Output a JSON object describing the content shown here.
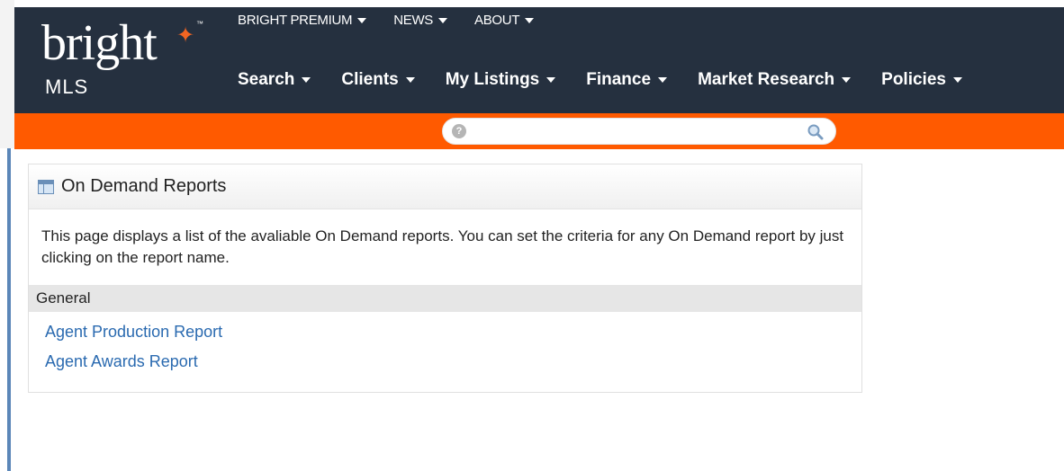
{
  "logo": {
    "word": "bright",
    "sub": "MLS",
    "tm": "™"
  },
  "topnav": [
    {
      "label": "BRIGHT PREMIUM"
    },
    {
      "label": "NEWS"
    },
    {
      "label": "ABOUT"
    }
  ],
  "mainnav": [
    {
      "label": "Search"
    },
    {
      "label": "Clients"
    },
    {
      "label": "My Listings"
    },
    {
      "label": "Finance"
    },
    {
      "label": "Market Research"
    },
    {
      "label": "Policies"
    }
  ],
  "search": {
    "value": "",
    "help": "?"
  },
  "panel": {
    "title": "On Demand Reports",
    "description": "This page displays a list of the avaliable On Demand reports. You can set the criteria for any On Demand report by just clicking on the report name.",
    "section": "General",
    "reports": [
      {
        "label": "Agent Production Report"
      },
      {
        "label": "Agent Awards Report"
      }
    ]
  },
  "colors": {
    "header": "#25303f",
    "orange": "#ff5a00",
    "link": "#2a6ab0"
  }
}
